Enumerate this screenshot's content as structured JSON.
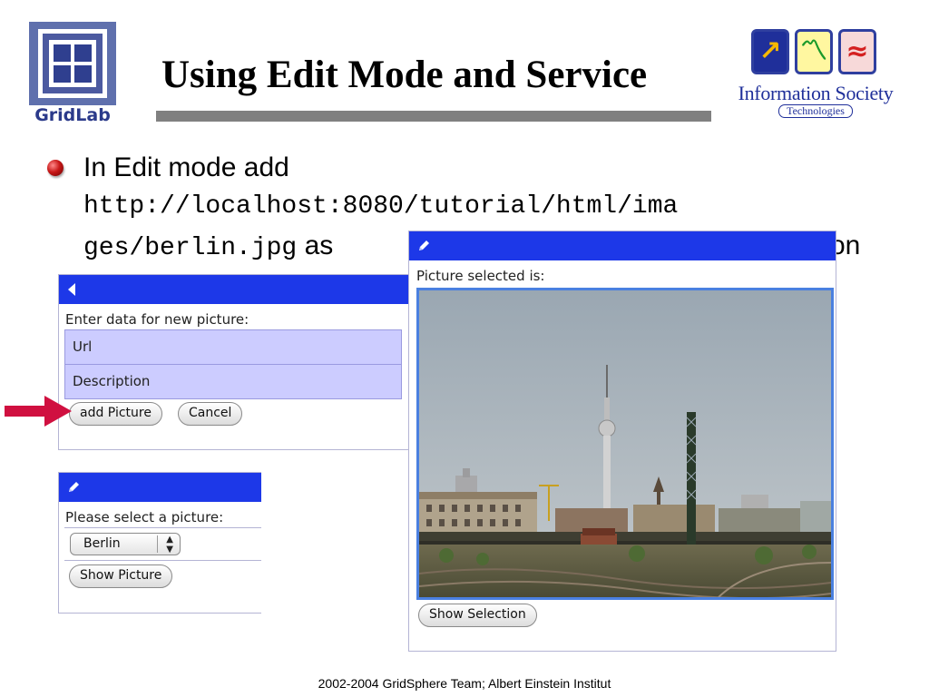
{
  "header": {
    "left_logo_text": "GridLab",
    "title": "Using Edit Mode and Service",
    "right_logo": {
      "name": "Information Society",
      "subtitle": "Technologies"
    }
  },
  "bullet": {
    "lead": "In Edit mode add",
    "url_line1": "http://localhost:8080/tutorial/html/ima",
    "url_line2": "ges/berlin.jpg",
    "trailing": "as",
    "tail": "on"
  },
  "edit_portlet": {
    "back_icon": "triangle-left-icon",
    "prompt": "Enter data for new picture:",
    "url_field": "Url",
    "description_field": "Description",
    "add_button": "add Picture",
    "cancel_button": "Cancel"
  },
  "select_portlet": {
    "edit_icon": "pencil-icon",
    "prompt": "Please select a picture:",
    "selected_option": "Berlin",
    "show_button": "Show Picture"
  },
  "picture_portlet": {
    "edit_icon": "pencil-icon",
    "heading": "Picture selected is:",
    "show_selection_button": "Show Selection"
  },
  "footer": {
    "text": "2002-2004 GridSphere Team; Albert Einstein Institut"
  },
  "colors": {
    "portlet_titlebar": "#1d38e8",
    "input_fill": "#ccccff",
    "arrow": "#d01040",
    "photo_border": "#4a80e0"
  }
}
